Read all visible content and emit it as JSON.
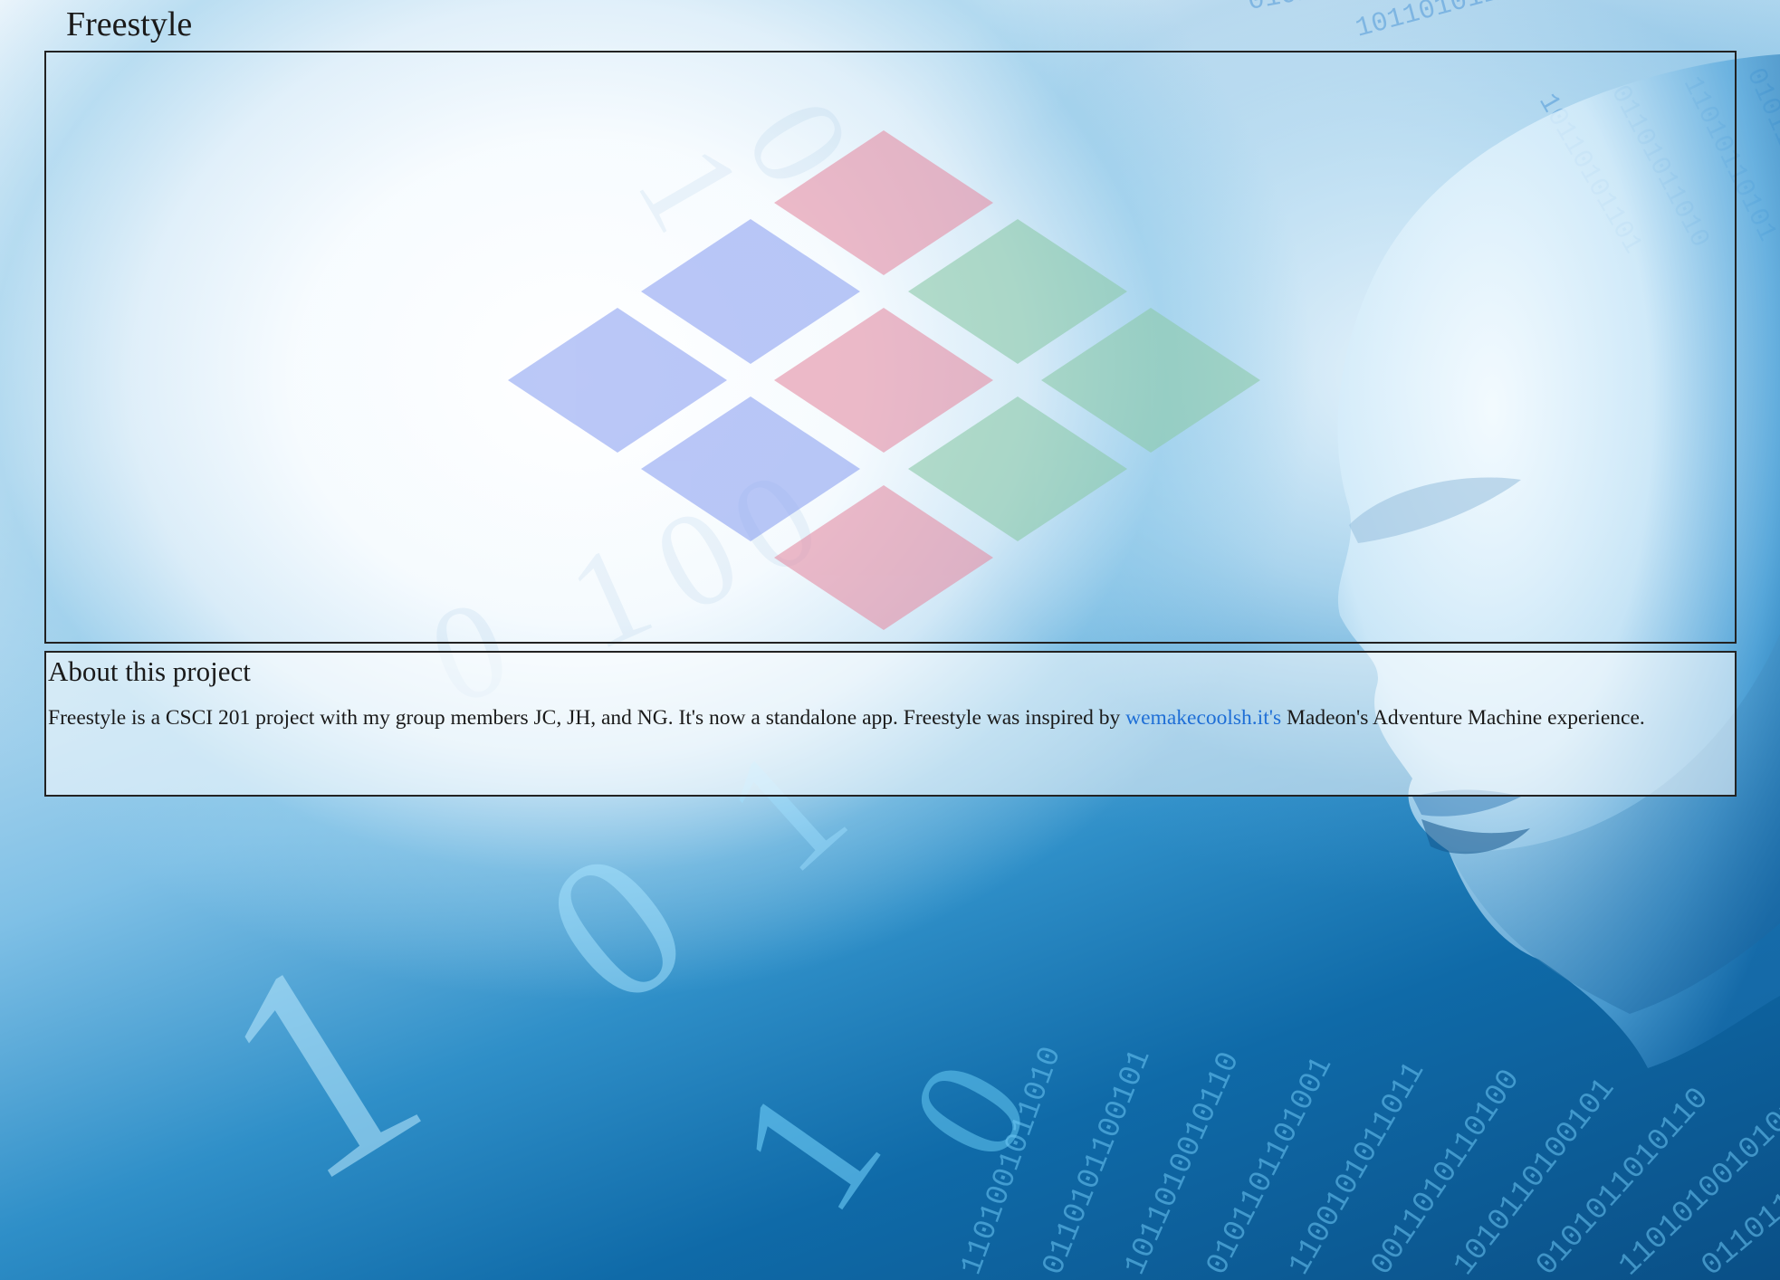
{
  "page": {
    "title": "Freestyle"
  },
  "about": {
    "heading": "About this project",
    "text_before_link": "Freestyle is a CSCI 201 project with my group members JC, JH, and NG. It's now a standalone app. Freestyle was inspired by ",
    "link_text": "wemakecoolsh.it's",
    "text_after_link": " Madeon's Adventure Machine experience."
  },
  "logo": {
    "icon": "diamond-grid-logo",
    "colors": {
      "red": "#e8a3b3",
      "blue": "#a9b8f4",
      "green": "#a7d8c0"
    }
  },
  "background": {
    "icon": "binary-code-face-background",
    "digits": [
      "1",
      "0",
      "1",
      "1",
      "0",
      "1",
      "0",
      "1",
      "1",
      "0"
    ]
  }
}
